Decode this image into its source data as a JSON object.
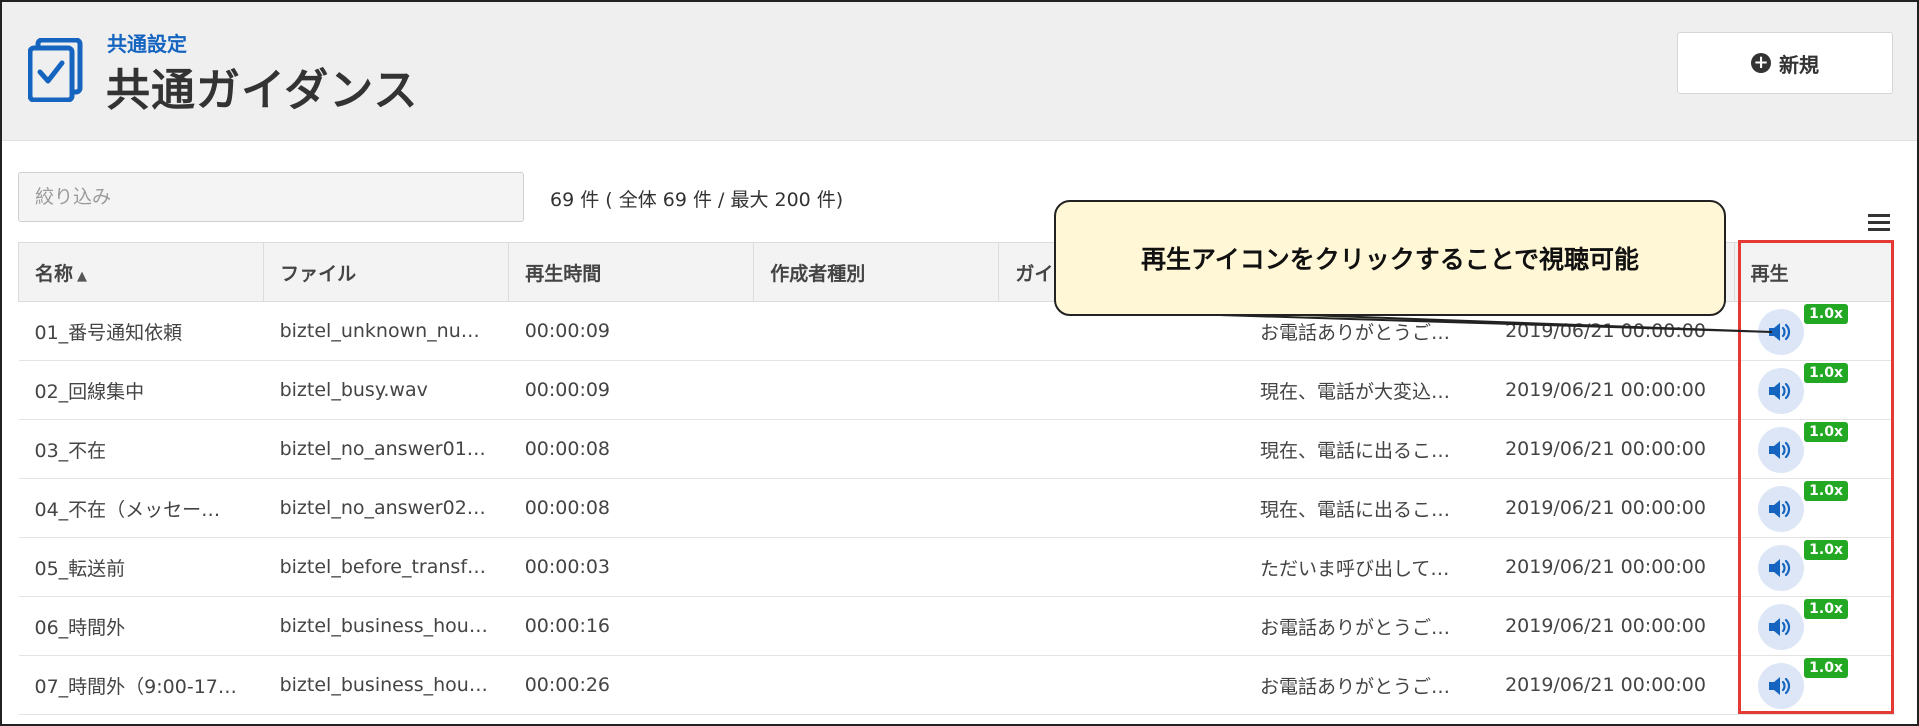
{
  "header": {
    "breadcrumb": "共通設定",
    "title": "共通ガイダンス",
    "new_button_label": "新規",
    "new_button_icon": "plus-circle-icon"
  },
  "filter": {
    "placeholder": "絞り込み",
    "value": "",
    "count_text": "69 件 ( 全体 69 件 / 最大 200 件)"
  },
  "table": {
    "columns": [
      "名称",
      "ファイル",
      "再生時間",
      "作成者種別",
      "ガイ",
      "",
      "",
      "再生"
    ],
    "sort_indicator": "▲",
    "rows": [
      {
        "name": "01_番号通知依頼",
        "file": "biztel_unknown_nu…",
        "duration": "00:00:09",
        "creator": "",
        "guidance": "",
        "text": "お電話ありがとうご…",
        "updated": "2019/06/21 00:00:00",
        "speed": "1.0x"
      },
      {
        "name": "02_回線集中",
        "file": "biztel_busy.wav",
        "duration": "00:00:09",
        "creator": "",
        "guidance": "",
        "text": "現在、電話が大変込…",
        "updated": "2019/06/21 00:00:00",
        "speed": "1.0x"
      },
      {
        "name": "03_不在",
        "file": "biztel_no_answer01…",
        "duration": "00:00:08",
        "creator": "",
        "guidance": "",
        "text": "現在、電話に出るこ…",
        "updated": "2019/06/21 00:00:00",
        "speed": "1.0x"
      },
      {
        "name": "04_不在（メッセー…",
        "file": "biztel_no_answer02…",
        "duration": "00:00:08",
        "creator": "",
        "guidance": "",
        "text": "現在、電話に出るこ…",
        "updated": "2019/06/21 00:00:00",
        "speed": "1.0x"
      },
      {
        "name": "05_転送前",
        "file": "biztel_before_transf…",
        "duration": "00:00:03",
        "creator": "",
        "guidance": "",
        "text": "ただいま呼び出して…",
        "updated": "2019/06/21 00:00:00",
        "speed": "1.0x"
      },
      {
        "name": "06_時間外",
        "file": "biztel_business_hou…",
        "duration": "00:00:16",
        "creator": "",
        "guidance": "",
        "text": "お電話ありがとうご…",
        "updated": "2019/06/21 00:00:00",
        "speed": "1.0x"
      },
      {
        "name": "07_時間外（9:00-17…",
        "file": "biztel_business_hou…",
        "duration": "00:00:26",
        "creator": "",
        "guidance": "",
        "text": "お電話ありがとうご…",
        "updated": "2019/06/21 00:00:00",
        "speed": "1.0x"
      }
    ]
  },
  "callout": {
    "text": "再生アイコンをクリックすることで視聴可能"
  },
  "colors": {
    "accent_blue": "#1565c0",
    "highlight_red": "#e53935",
    "badge_green": "#22a822",
    "callout_bg": "#fff7d6"
  }
}
